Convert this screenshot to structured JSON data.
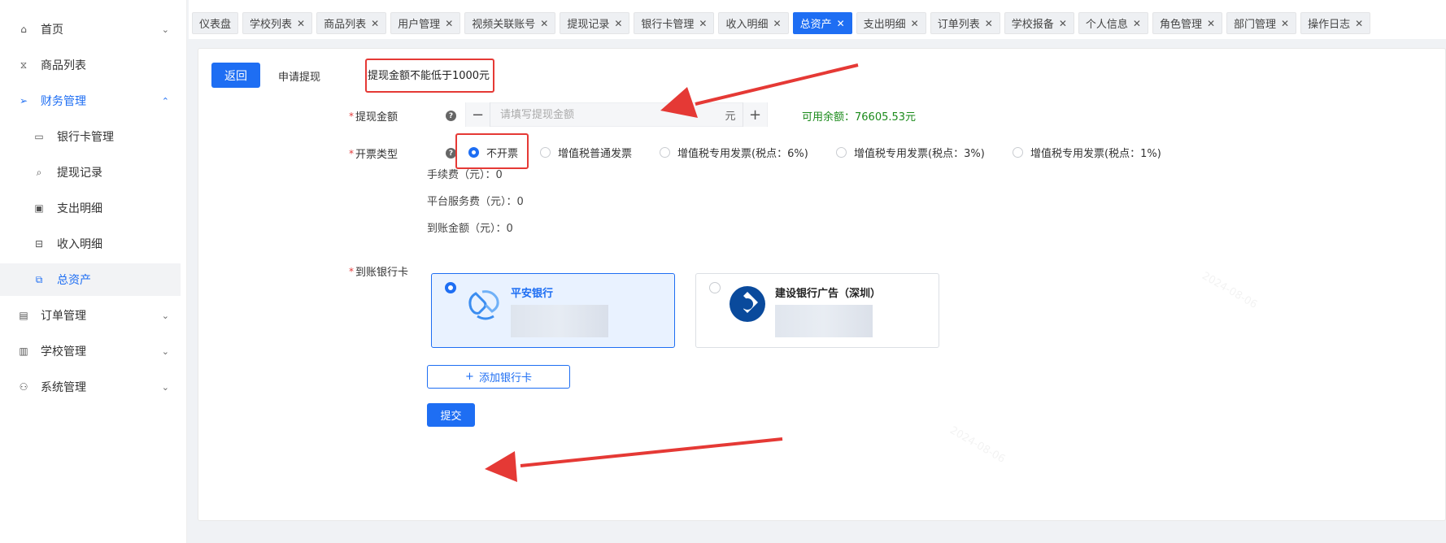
{
  "sidebar": {
    "items": [
      {
        "label": "首页",
        "icon": "home-icon",
        "glyph": "⌂",
        "chevron": "⌄"
      },
      {
        "label": "商品列表",
        "icon": "product-icon",
        "glyph": "⧖",
        "chevron": ""
      },
      {
        "label": "财务管理",
        "icon": "finance-icon",
        "glyph": "➢",
        "chevron": "⌃"
      },
      {
        "label": "银行卡管理",
        "icon": "bank-card-icon",
        "glyph": "▭"
      },
      {
        "label": "提现记录",
        "icon": "withdraw-record-icon",
        "glyph": "⌕"
      },
      {
        "label": "支出明细",
        "icon": "expense-icon",
        "glyph": "▣"
      },
      {
        "label": "收入明细",
        "icon": "income-icon",
        "glyph": "⊟"
      },
      {
        "label": "总资产",
        "icon": "assets-icon",
        "glyph": "⧉"
      },
      {
        "label": "订单管理",
        "icon": "order-icon",
        "glyph": "▤",
        "chevron": "⌄"
      },
      {
        "label": "学校管理",
        "icon": "school-icon",
        "glyph": "▥",
        "chevron": "⌄"
      },
      {
        "label": "系统管理",
        "icon": "system-icon",
        "glyph": "⚇",
        "chevron": "⌄"
      }
    ]
  },
  "tabs": [
    {
      "label": "仪表盘",
      "closable": false
    },
    {
      "label": "学校列表",
      "closable": true
    },
    {
      "label": "商品列表",
      "closable": true
    },
    {
      "label": "用户管理",
      "closable": true
    },
    {
      "label": "视频关联账号",
      "closable": true
    },
    {
      "label": "提现记录",
      "closable": true
    },
    {
      "label": "银行卡管理",
      "closable": true
    },
    {
      "label": "收入明细",
      "closable": true
    },
    {
      "label": "总资产",
      "closable": true,
      "active": true
    },
    {
      "label": "支出明细",
      "closable": true
    },
    {
      "label": "订单列表",
      "closable": true
    },
    {
      "label": "学校报备",
      "closable": true
    },
    {
      "label": "个人信息",
      "closable": true
    },
    {
      "label": "角色管理",
      "closable": true
    },
    {
      "label": "部门管理",
      "closable": true
    },
    {
      "label": "操作日志",
      "closable": true
    }
  ],
  "close_glyph": "✕",
  "page": {
    "back_label": "返回",
    "title": "申请提现",
    "tooltip": "提现金额不能低于1000元",
    "amount": {
      "label": "提现金额",
      "placeholder": "请填写提现金额",
      "value": "",
      "unit": "元",
      "minus": "−",
      "plus": "+",
      "balance": "可用余额：76605.53元"
    },
    "invoice": {
      "label": "开票类型",
      "options": [
        "不开票",
        "增值税普通发票",
        "增值税专用发票(税点：6%)",
        "增值税专用发票(税点：3%)",
        "增值税专用发票(税点：1%)"
      ],
      "selected": "不开票"
    },
    "fees": {
      "handling": "手续费（元）：0",
      "platform": "平台服务费（元）：0",
      "arrival": "到账金额（元）：0"
    },
    "bank": {
      "label": "到账银行卡",
      "cards": [
        {
          "name": "平安银行",
          "selected": true,
          "logo": "pingan-bank-logo"
        },
        {
          "name": "建设银行广告（深圳）",
          "selected": false,
          "logo": "ccb-bank-logo"
        }
      ]
    },
    "add_card_label": "添加银行卡",
    "add_card_glyph": "+",
    "submit_label": "提交"
  },
  "colors": {
    "accent": "#1e6ef3",
    "balance": "#1a8a1a",
    "annotation": "#e53935"
  }
}
